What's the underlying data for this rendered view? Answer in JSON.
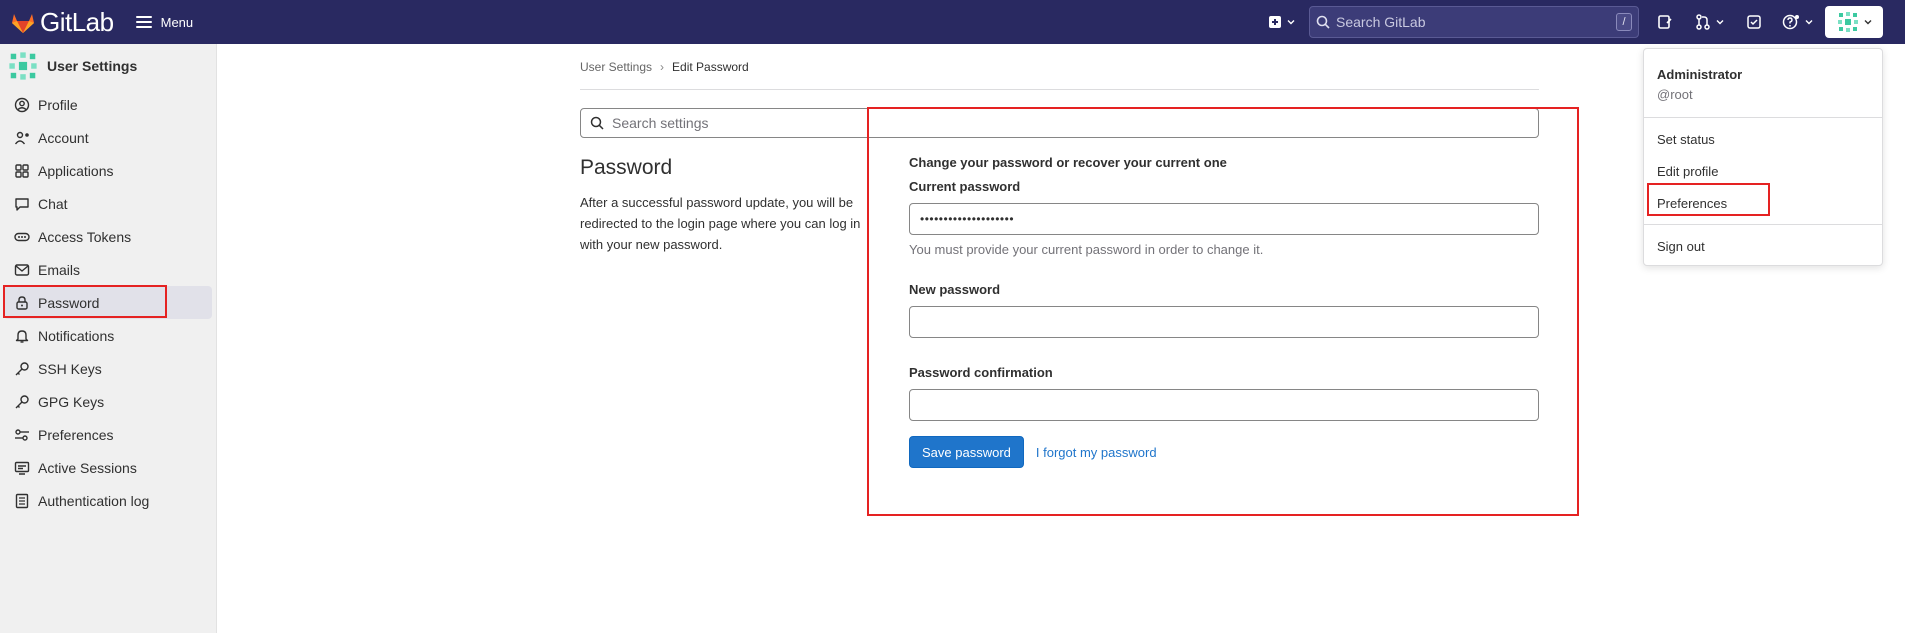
{
  "navbar": {
    "brand": "GitLab",
    "menu_label": "Menu",
    "search_placeholder": "Search GitLab",
    "search_shortcut": "/"
  },
  "sidebar": {
    "title": "User Settings",
    "items": [
      {
        "label": "Profile",
        "icon": "profile-icon"
      },
      {
        "label": "Account",
        "icon": "account-icon"
      },
      {
        "label": "Applications",
        "icon": "applications-icon"
      },
      {
        "label": "Chat",
        "icon": "chat-icon"
      },
      {
        "label": "Access Tokens",
        "icon": "token-icon"
      },
      {
        "label": "Emails",
        "icon": "mail-icon"
      },
      {
        "label": "Password",
        "icon": "lock-icon"
      },
      {
        "label": "Notifications",
        "icon": "bell-icon"
      },
      {
        "label": "SSH Keys",
        "icon": "key-icon"
      },
      {
        "label": "GPG Keys",
        "icon": "key-icon"
      },
      {
        "label": "Preferences",
        "icon": "preferences-icon"
      },
      {
        "label": "Active Sessions",
        "icon": "monitor-icon"
      },
      {
        "label": "Authentication log",
        "icon": "log-icon"
      }
    ]
  },
  "breadcrumb": {
    "parent": "User Settings",
    "current": "Edit Password"
  },
  "settings_search": {
    "placeholder": "Search settings"
  },
  "section": {
    "title": "Password",
    "description": "After a successful password update, you will be redirected to the login page where you can log in with your new password."
  },
  "form": {
    "heading": "Change your password or recover your current one",
    "current_password_label": "Current password",
    "current_password_value": "••••••••••••••••••••",
    "current_password_help": "You must provide your current password in order to change it.",
    "new_password_label": "New password",
    "new_password_value": "",
    "confirmation_label": "Password confirmation",
    "confirmation_value": "",
    "save_button": "Save password",
    "forgot_link": "I forgot my password"
  },
  "user_menu": {
    "name": "Administrator",
    "handle": "@root",
    "items": [
      "Set status",
      "Edit profile",
      "Preferences",
      "Sign out"
    ]
  },
  "colors": {
    "navbar_bg": "#292961",
    "primary": "#1f75cb",
    "highlight": "#e52222"
  }
}
